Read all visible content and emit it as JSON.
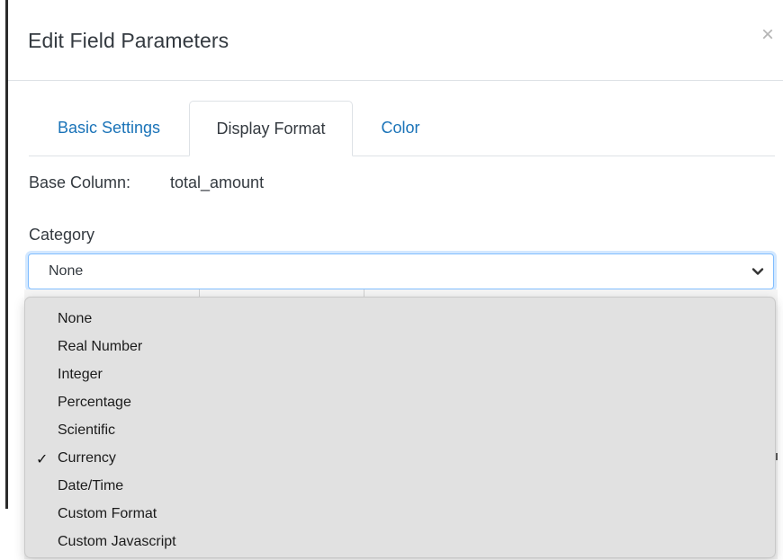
{
  "modal": {
    "title": "Edit Field Parameters",
    "close_symbol": "×"
  },
  "tabs": [
    {
      "label": "Basic Settings",
      "active": false
    },
    {
      "label": "Display Format",
      "active": true
    },
    {
      "label": "Color",
      "active": false
    }
  ],
  "base_column": {
    "label": "Base Column:",
    "value": "total_amount"
  },
  "category": {
    "label": "Category",
    "selected_display": "None",
    "options": [
      {
        "label": "None",
        "checked": false
      },
      {
        "label": "Real Number",
        "checked": false
      },
      {
        "label": "Integer",
        "checked": false
      },
      {
        "label": "Percentage",
        "checked": false
      },
      {
        "label": "Scientific",
        "checked": false
      },
      {
        "label": "Currency",
        "checked": true
      },
      {
        "label": "Date/Time",
        "checked": false
      },
      {
        "label": "Custom Format",
        "checked": false
      },
      {
        "label": "Custom Javascript",
        "checked": false
      }
    ],
    "check_symbol": "✓"
  },
  "colors": {
    "link_tab": "#1a73b8",
    "focus_border": "#80bdff",
    "menu_bg": "#e1e1e1"
  },
  "icons": {
    "close": "close-icon",
    "chevron": "chevron-down-icon",
    "check": "check-icon"
  }
}
